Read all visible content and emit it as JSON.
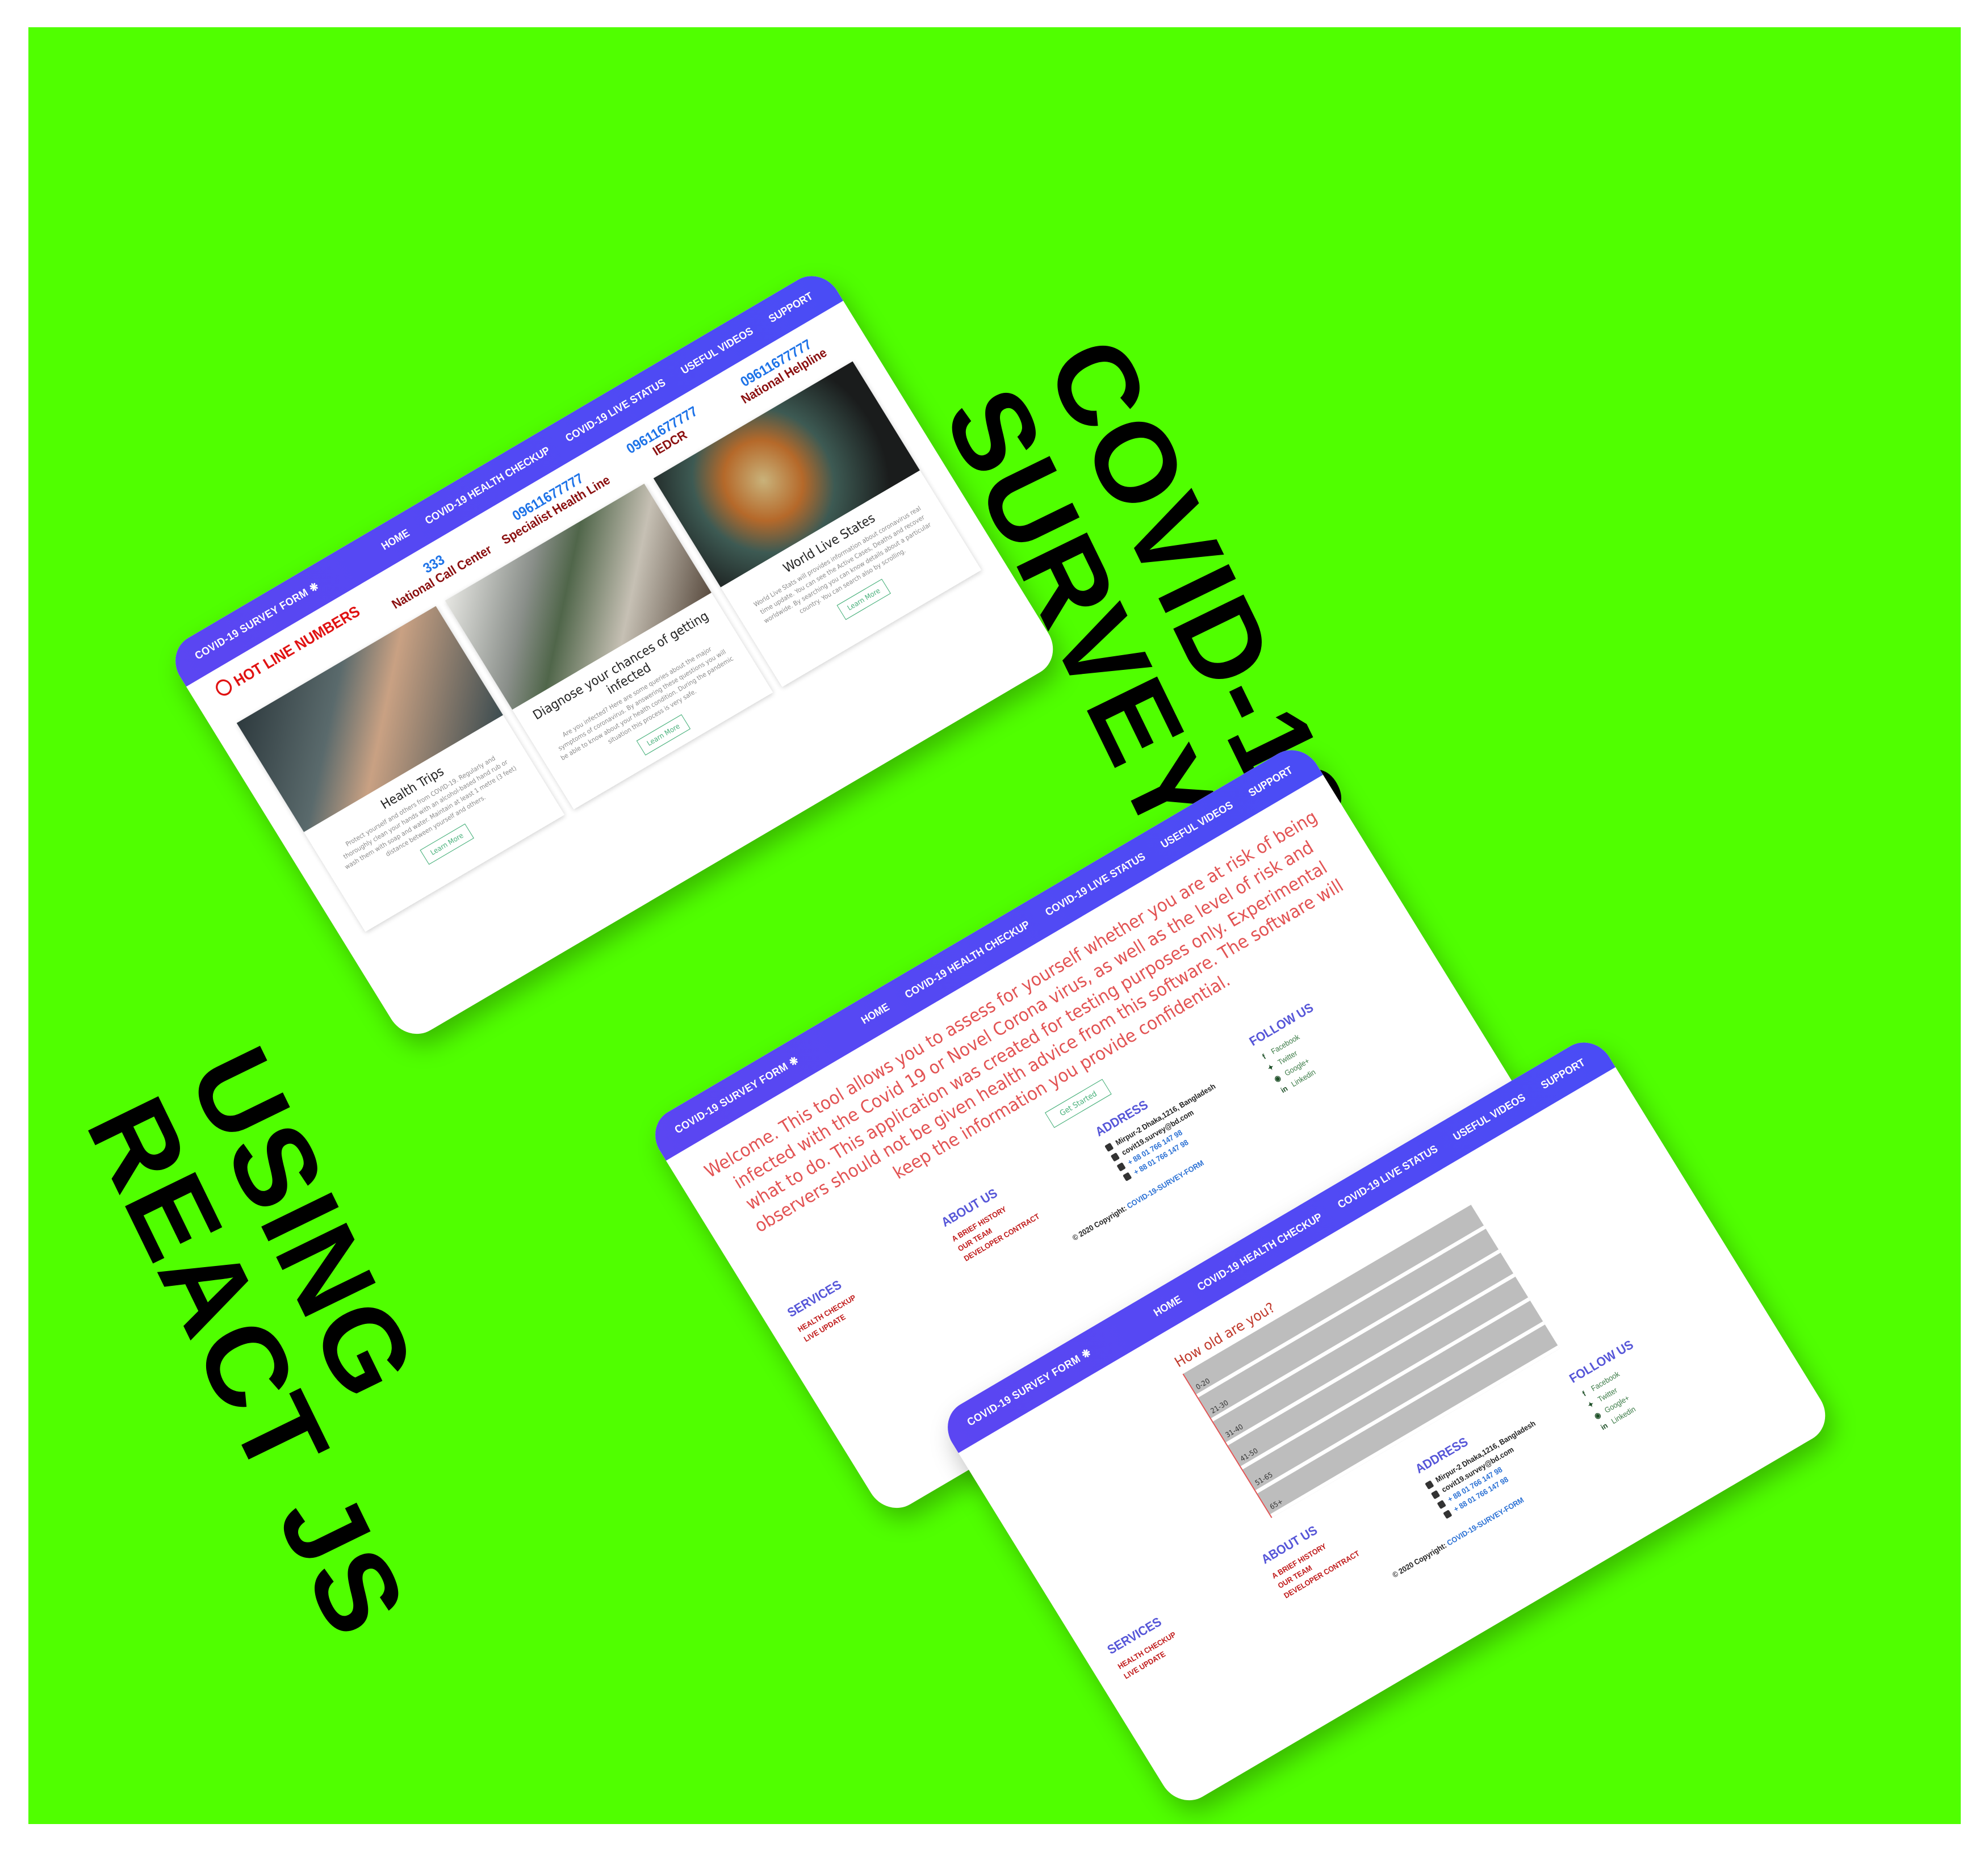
{
  "headline": {
    "title_lines": [
      "COVID-19",
      "SURVEY FORM"
    ],
    "subtitle_lines": [
      "USING",
      "REACT JS"
    ]
  },
  "nav": {
    "brand": "COVID-19 SURVEY FORM",
    "brand_icon": "❋",
    "links": [
      "HOME",
      "COVID-19 HEALTH CHECKUP",
      "COVID-19 LIVE STATUS",
      "USEFUL VIDEOS",
      "SUPPORT"
    ]
  },
  "hotline": {
    "title": "HOT LINE NUMBERS",
    "items": [
      {
        "number": "333",
        "label": "National Call Center"
      },
      {
        "number": "09611677777",
        "label": "Specialist Health Line"
      },
      {
        "number": "09611677777",
        "label": "IEDCR"
      },
      {
        "number": "09611677777",
        "label": "National Helpline"
      }
    ]
  },
  "cards": [
    {
      "title": "Health Trips",
      "text": "Protect yourself and others from COVID-19. Regularly and thoroughly clean your hands with an alcohol-based hand rub or wash them with soap and water. Maintain at least 1 metre (3 feet) distance between yourself and others.",
      "button": "Learn More"
    },
    {
      "title": "Diagnose your chances of getting infected",
      "text": "Are you infected? Here are some queries about the major symptoms of coronavirus. By answering these questions you will be able to know about your health condition. During the pandemic situation this process is very safe.",
      "button": "Learn More"
    },
    {
      "title": "World Live States",
      "text": "World Live Stats will provides information about coronavirus real time update. You can see the Active Cases, Deaths and recover worldwide. By searching you can know details about a particular country. You can search also by scrolling.",
      "button": "Learn More"
    }
  ],
  "footer": {
    "services": {
      "heading": "SERVICES",
      "links": [
        "HEALTH CHECKUP",
        "LIVE UPDATE"
      ]
    },
    "about": {
      "heading": "ABOUT US",
      "links": [
        "A BRIEF HISTORY",
        "OUR TEAM",
        "DEVELOPER CONTRACT"
      ]
    },
    "address": {
      "heading": "ADDRESS",
      "location": "Mirpur-2 Dhaka,1216, Bangladesh",
      "email": "covit19.survey@bd.com",
      "phone": "+ 88 01 766 147 98",
      "fax": "+ 88 01 766 147 98"
    },
    "follow": {
      "heading": "FOLLOW US",
      "links": [
        "Facebook",
        "Twitter",
        "Google+",
        "Linkedin"
      ]
    },
    "copyright_prefix": "© 2020 Copyright:",
    "copyright_link": "COVID-19-SURVEY-FORM"
  },
  "welcome": {
    "text": "Welcome. This tool allows you to assess for yourself whether you are at risk of being infected with the Covid 19 or Novel Corona virus, as well as the level of risk and what to do. This application was created for testing purposes only. Experimental observers should not be given health advice from this software. The software will keep the information you provide confidential.",
    "button": "Get Started"
  },
  "survey": {
    "question": "How old are you?",
    "options": [
      "0-20",
      "21-30",
      "31-40",
      "41-50",
      "51-65",
      "65+"
    ]
  },
  "colors": {
    "background": "#50ff00",
    "nav": "#5b46f2",
    "hotline_title": "#e01212",
    "footer_heading": "#5656d8"
  }
}
